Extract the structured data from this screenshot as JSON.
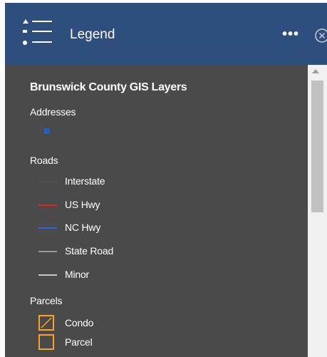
{
  "header": {
    "title": "Legend",
    "icon": "legend-list-icon",
    "more_icon": "more-icon",
    "close_icon": "close-icon",
    "background": "#2e4f7e"
  },
  "layer": {
    "title": "Brunswick County GIS Layers",
    "groups": {
      "addresses": {
        "label": "Addresses",
        "symbol_color": "#1f5fc2"
      },
      "roads": {
        "label": "Roads",
        "items": [
          {
            "label": "Interstate",
            "color": "#4e4e4e"
          },
          {
            "label": "US Hwy",
            "color": "#e8231a"
          },
          {
            "label": "NC Hwy",
            "color": "#2463e8"
          },
          {
            "label": "State Road",
            "color": "#9a9a9a"
          },
          {
            "label": "Minor",
            "color": "#c8c8c8"
          }
        ]
      },
      "parcels": {
        "label": "Parcels",
        "items": [
          {
            "label": "Condo",
            "color": "#f5a623",
            "hatched": true
          },
          {
            "label": "Parcel",
            "color": "#f5a623",
            "hatched": false
          }
        ]
      }
    }
  }
}
